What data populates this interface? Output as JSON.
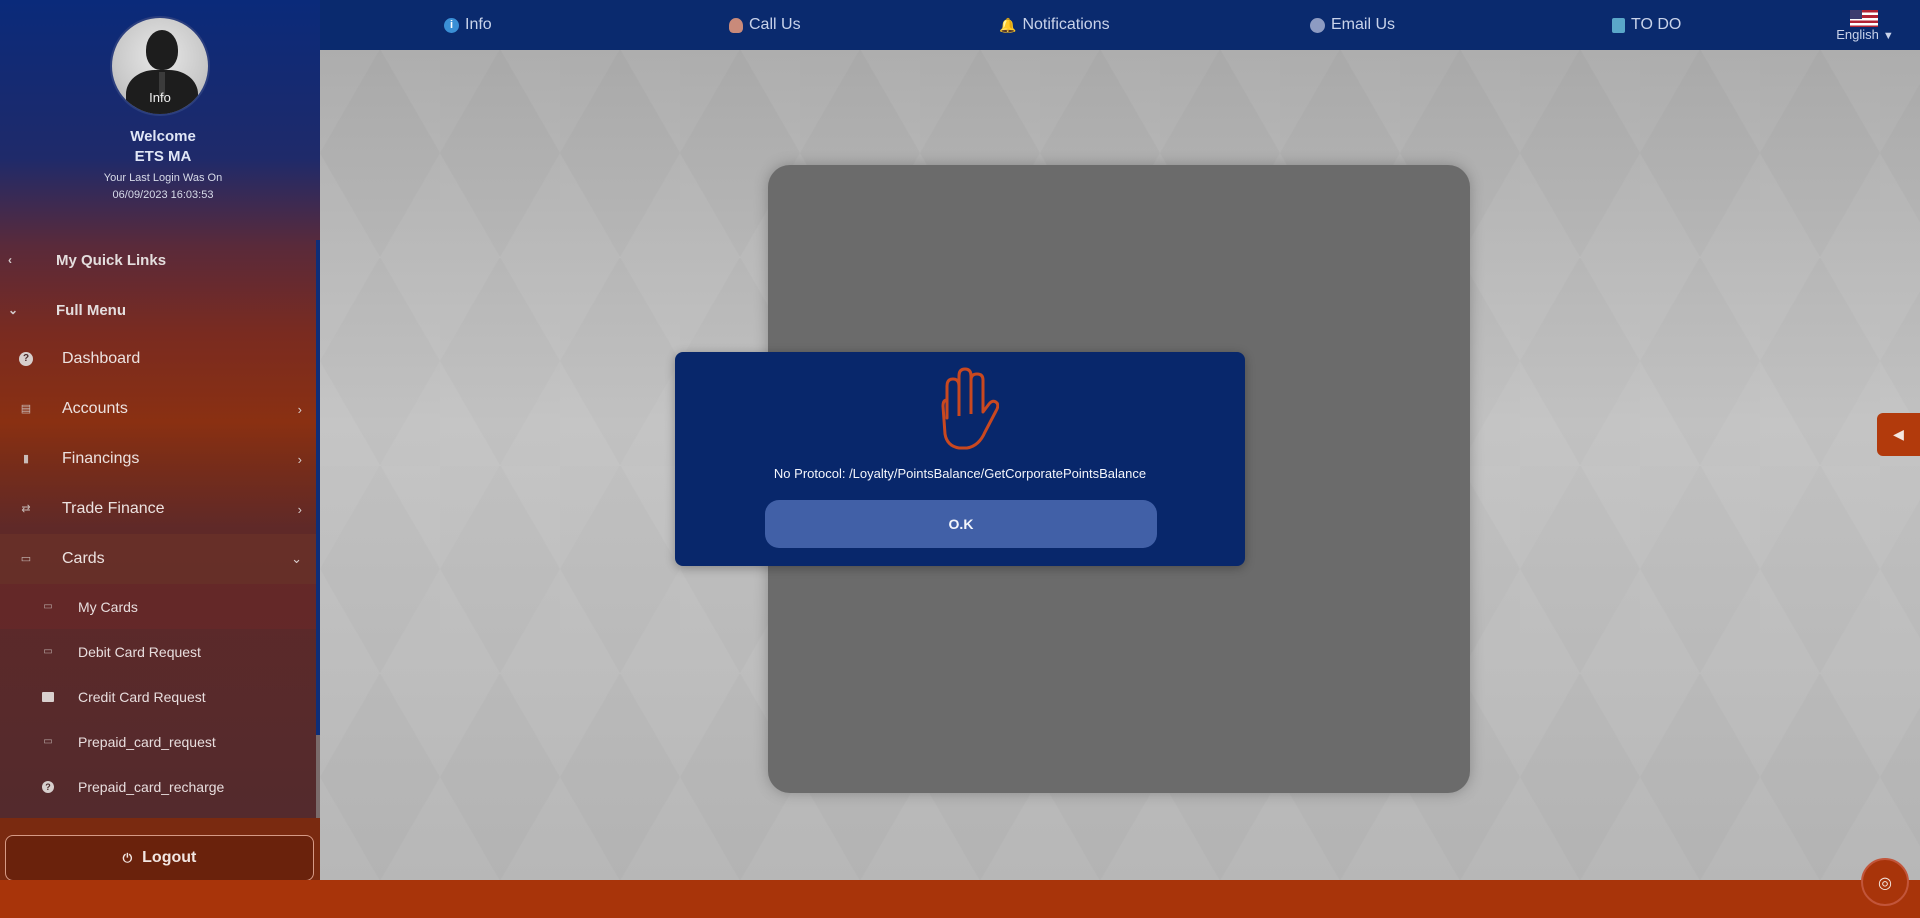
{
  "topnav": {
    "items": [
      {
        "label": "Info",
        "icon": "info-icon"
      },
      {
        "label": "Call Us",
        "icon": "phone-agent-icon"
      },
      {
        "label": "Notifications",
        "icon": "bell-icon"
      },
      {
        "label": "Email Us",
        "icon": "email-icon"
      },
      {
        "label": "TO DO",
        "icon": "todo-icon"
      }
    ],
    "language": "English"
  },
  "profile": {
    "avatar_label": "Info",
    "welcome": "Welcome",
    "name": "ETS MA",
    "last_login_label": "Your Last Login Was On",
    "last_login_value": "06/09/2023 16:03:53"
  },
  "sidebar": {
    "quick_links": "My Quick Links",
    "full_menu": "Full Menu",
    "items": [
      {
        "label": "Dashboard"
      },
      {
        "label": "Accounts"
      },
      {
        "label": "Financings"
      },
      {
        "label": "Trade Finance"
      },
      {
        "label": "Cards"
      }
    ],
    "cards_sub": [
      {
        "label": "My Cards"
      },
      {
        "label": "Debit Card Request"
      },
      {
        "label": "Credit Card Request"
      },
      {
        "label": "Prepaid_card_request"
      },
      {
        "label": "Prepaid_card_recharge"
      }
    ],
    "logout": "Logout"
  },
  "modal": {
    "message": "No Protocol: /Loyalty/PointsBalance/GetCorporatePointsBalance",
    "ok_label": "O.K",
    "icon": "stop-hand-icon"
  },
  "colors": {
    "topbar": "#0a2a6e",
    "accent": "#a8340a",
    "modal": "#08276b",
    "ok_button": "#4160a7"
  }
}
